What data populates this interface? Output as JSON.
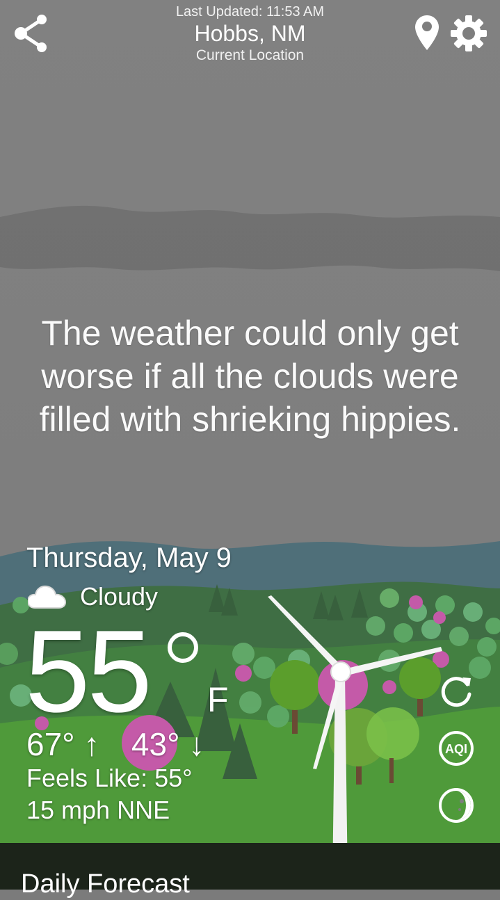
{
  "header": {
    "last_updated": "Last Updated: 11:53 AM",
    "city": "Hobbs, NM",
    "sub_location": "Current Location"
  },
  "icons": {
    "share": "share-icon",
    "location": "map-pin-icon",
    "settings": "gear-icon",
    "condition": "cloud-icon",
    "refresh": "refresh-icon",
    "aqi": "aqi-icon",
    "moon": "moon-phase-icon"
  },
  "quote": "The weather could only get worse if all the clouds were filled with shrieking hippies.",
  "current": {
    "date": "Thursday, May 9",
    "condition": "Cloudy",
    "temperature": "55",
    "unit": "F",
    "high": "67°",
    "high_arrow": "↑",
    "low": "43°",
    "low_arrow": "↓",
    "feels_like": "Feels Like: 55°",
    "wind": "15 mph NNE"
  },
  "side_buttons": {
    "aqi_label": "AQI"
  },
  "daily": {
    "title": "Daily Forecast"
  },
  "colors": {
    "sky": "#7e7e7e",
    "cloud_band": "#6d6d6d",
    "mountains": "#4d6e79",
    "hills": "#3f7a3e",
    "grass": "#4e9a3a",
    "blossom": "#c45aa8",
    "panel": "#1c241a"
  }
}
